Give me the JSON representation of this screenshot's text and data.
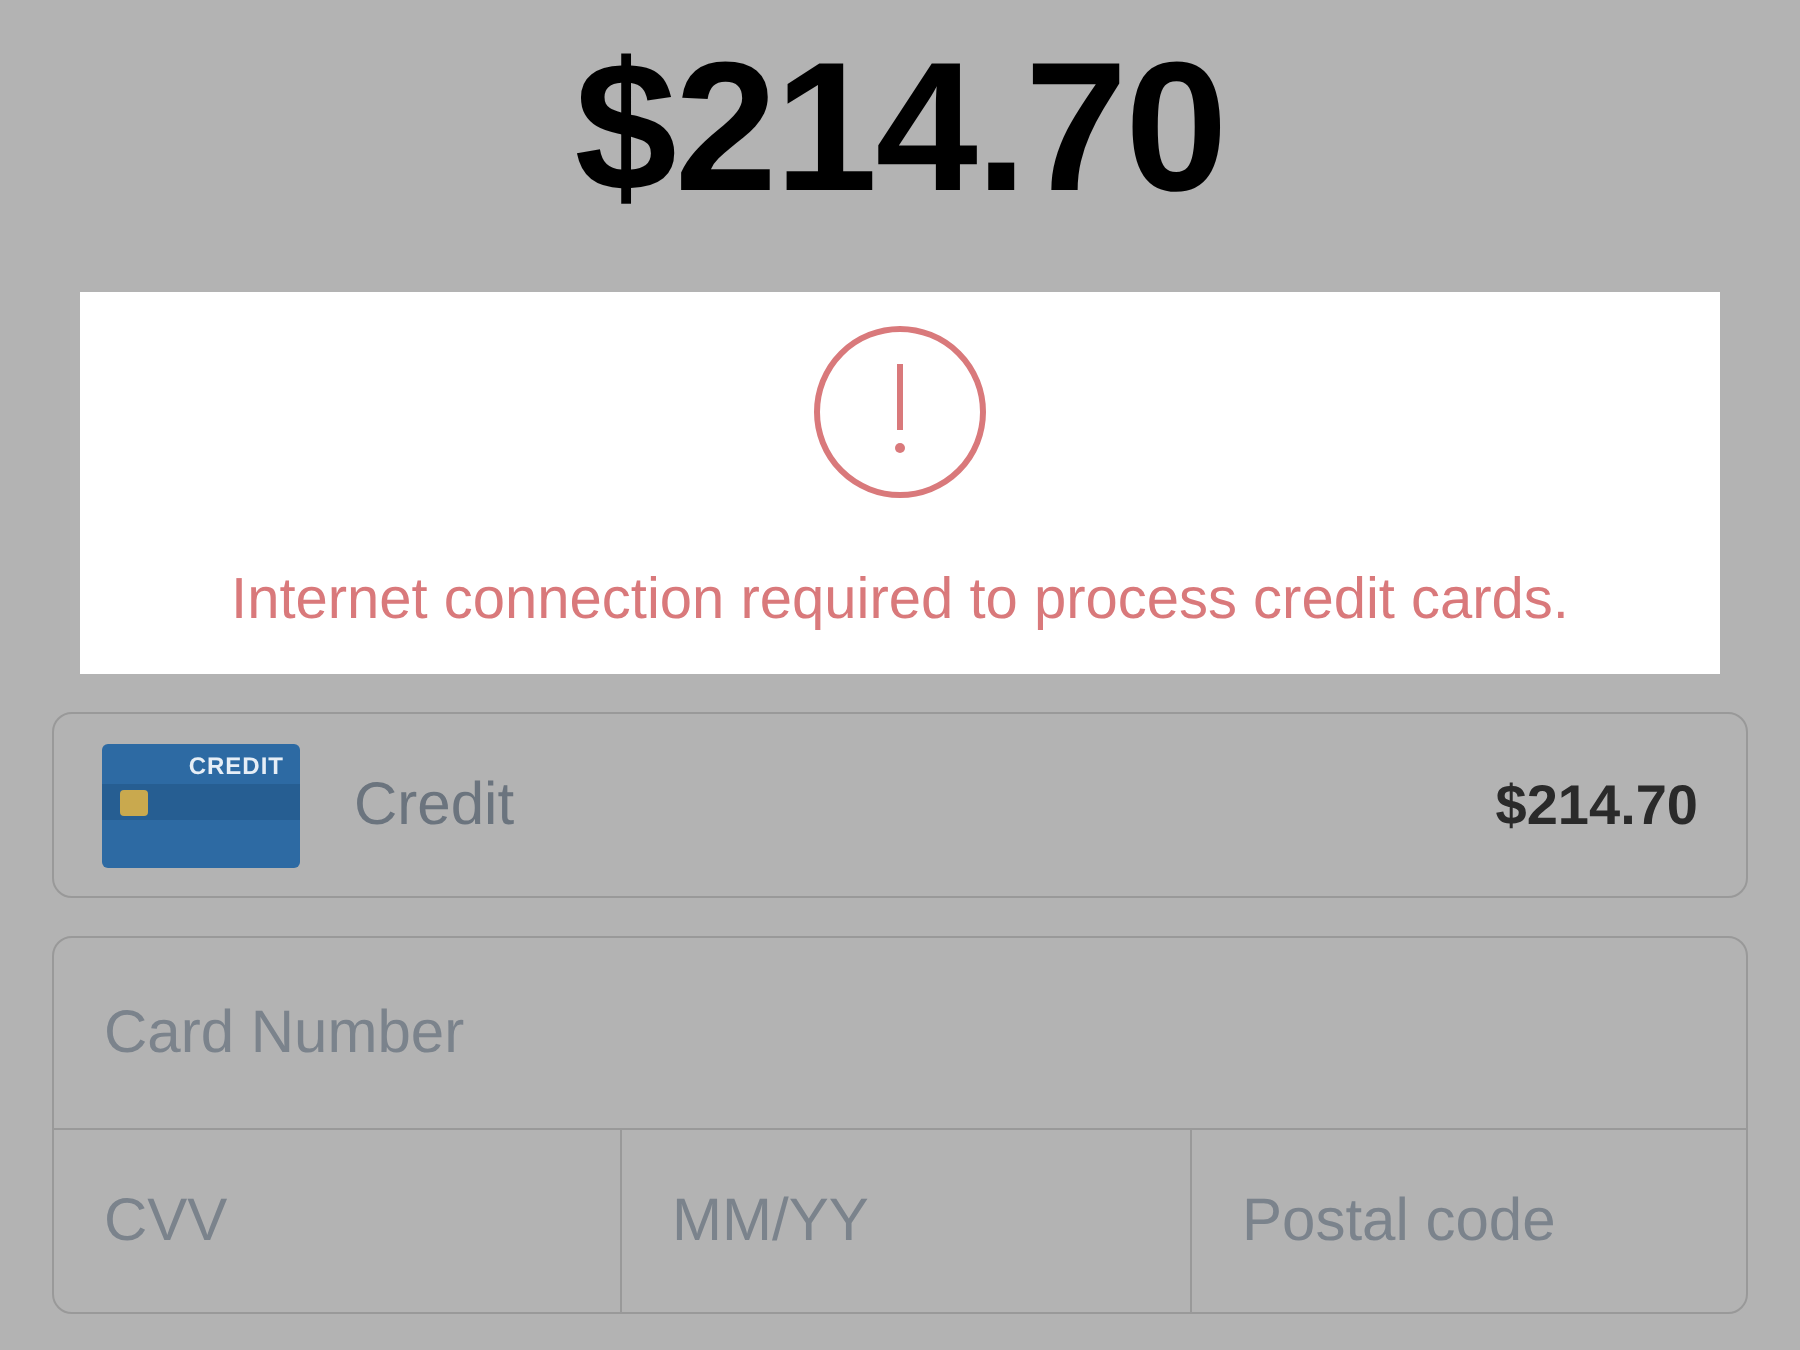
{
  "total": "$214.70",
  "alert": {
    "message": "Internet connection required to process credit cards."
  },
  "payment_method": {
    "card_label": "CREDIT",
    "name": "Credit",
    "amount": "$214.70"
  },
  "card_form": {
    "card_number": {
      "placeholder": "Card Number"
    },
    "fields": [
      {
        "placeholder": "CVV"
      },
      {
        "placeholder": "MM/YY"
      },
      {
        "placeholder": "Postal code"
      }
    ]
  }
}
